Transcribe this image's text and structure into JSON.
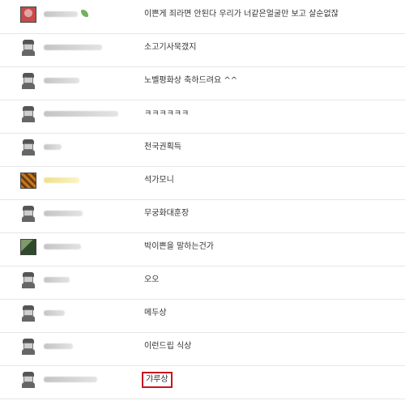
{
  "comments": [
    {
      "text": "이쁜게 죄라면 안된다 우리가 너같은얼굴만 보고 살순없잖",
      "avatar": "photo",
      "colors": [
        "#c84a4a",
        "#e0a6a6"
      ]
    },
    {
      "text": "소고기사묵갰지",
      "avatar": "default"
    },
    {
      "text": "노벨평화상 축하드려요 ^^",
      "avatar": "default"
    },
    {
      "text": "ㅋㅋㅋㅋㅋㅋ",
      "avatar": "default"
    },
    {
      "text": "천국권획득",
      "avatar": "default"
    },
    {
      "text": "석가모니",
      "avatar": "photo",
      "colors": [
        "#c4781e",
        "#6b3a12"
      ]
    },
    {
      "text": "무궁화대훈장",
      "avatar": "default"
    },
    {
      "text": "박이쁜을 말하는건가",
      "avatar": "photo",
      "colors": [
        "#2f4a2a",
        "#7e9a6a"
      ]
    },
    {
      "text": "오오",
      "avatar": "default"
    },
    {
      "text": "메두상",
      "avatar": "default"
    },
    {
      "text": "이런드립 식상",
      "avatar": "default"
    },
    {
      "text": "갸루상",
      "avatar": "default",
      "highlight": "#c8161d"
    }
  ]
}
